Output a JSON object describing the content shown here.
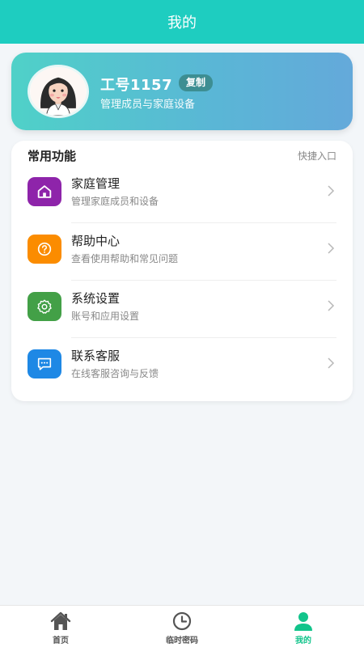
{
  "header": {
    "title": "我的"
  },
  "profile": {
    "user_id": "工号1157",
    "copy_label": "复制",
    "subtitle": "管理成员与家庭设备"
  },
  "functions": {
    "title": "常用功能",
    "link": "快捷入口",
    "items": [
      {
        "title": "家庭管理",
        "subtitle": "管理家庭成员和设备",
        "icon": "home-icon",
        "color": "#8e24aa"
      },
      {
        "title": "帮助中心",
        "subtitle": "查看使用帮助和常见问题",
        "icon": "help-icon",
        "color": "#fb8c00"
      },
      {
        "title": "系统设置",
        "subtitle": "账号和应用设置",
        "icon": "gear-icon",
        "color": "#43a047"
      },
      {
        "title": "联系客服",
        "subtitle": "在线客服咨询与反馈",
        "icon": "chat-icon",
        "color": "#1e88e5"
      }
    ]
  },
  "tabbar": {
    "tabs": [
      {
        "label": "首页",
        "icon": "house-icon",
        "active": false
      },
      {
        "label": "临时密码",
        "icon": "clock-icon",
        "active": false
      },
      {
        "label": "我的",
        "icon": "person-icon",
        "active": true
      }
    ],
    "active_color": "#12c48b"
  },
  "colors": {
    "header": "#1ecdc0",
    "accent": "#12c48b"
  }
}
